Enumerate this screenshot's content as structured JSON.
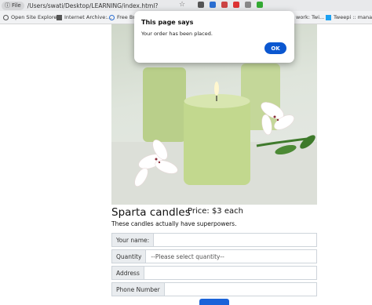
{
  "browser": {
    "file_chip": "File",
    "url": "/Users/swati/Desktop/LEARNING/index.html?",
    "bookmarks": [
      "Open Site Explorer",
      "Internet Archive:...",
      "Free Bro",
      "work: Twi...",
      "Tweepi :: mana..."
    ]
  },
  "dialog": {
    "title": "This page says",
    "message": "Your order has been placed.",
    "ok_label": "OK"
  },
  "product": {
    "title": "Sparta candles",
    "price": "Price: $3 each",
    "tagline": "These candles actually have superpowers."
  },
  "form": {
    "name_label": "Your name:",
    "quantity_label": "Quantity",
    "quantity_placeholder": "--Please select quantity--",
    "address_label": "Address",
    "phone_label": "Phone Number"
  },
  "colors": {
    "accent": "#0b57d0",
    "submit": "#1a63d9"
  }
}
